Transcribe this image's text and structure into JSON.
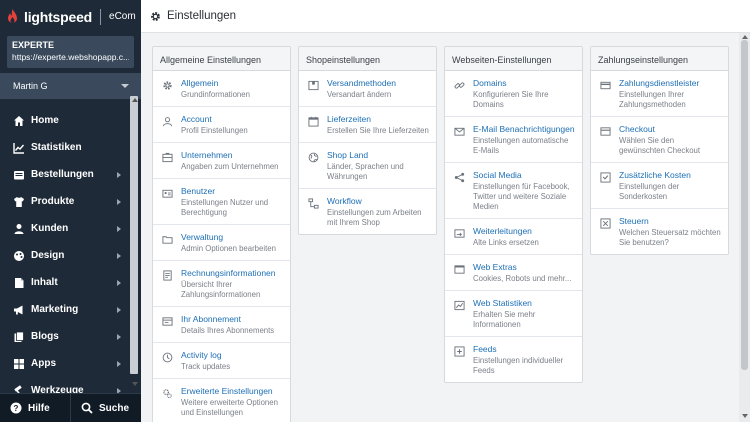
{
  "sidebar": {
    "logo_text": "lightspeed",
    "logo_product": "eCom",
    "shop_name": "EXPERTE",
    "shop_url": "https://experte.webshopapp.c...",
    "user_name": "Martin G",
    "items": [
      {
        "label": "Home",
        "icon": "home-icon",
        "has_children": false
      },
      {
        "label": "Statistiken",
        "icon": "chart-icon",
        "has_children": false
      },
      {
        "label": "Bestellungen",
        "icon": "inbox-icon",
        "has_children": true
      },
      {
        "label": "Produkte",
        "icon": "tshirt-icon",
        "has_children": true
      },
      {
        "label": "Kunden",
        "icon": "users-icon",
        "has_children": true
      },
      {
        "label": "Design",
        "icon": "palette-icon",
        "has_children": true
      },
      {
        "label": "Inhalt",
        "icon": "content-icon",
        "has_children": true
      },
      {
        "label": "Marketing",
        "icon": "megaphone-icon",
        "has_children": true
      },
      {
        "label": "Blogs",
        "icon": "blog-icon",
        "has_children": true
      },
      {
        "label": "Apps",
        "icon": "apps-icon",
        "has_children": true
      },
      {
        "label": "Werkzeuge",
        "icon": "hammer-icon",
        "has_children": true
      }
    ],
    "footer": {
      "help_label": "Hilfe",
      "search_label": "Suche"
    }
  },
  "header": {
    "title": "Einstellungen",
    "icon": "gear-icon"
  },
  "columns": [
    {
      "title": "Allgemeine Einstellungen",
      "items": [
        {
          "title": "Allgemein",
          "desc": "Grundinformationen",
          "icon": "gear-icon"
        },
        {
          "title": "Account",
          "desc": "Profil Einstellungen",
          "icon": "user-icon"
        },
        {
          "title": "Unternehmen",
          "desc": "Angaben zum Unternehmen",
          "icon": "card-icon"
        },
        {
          "title": "Benutzer",
          "desc": "Einstellungen Nutzer und Berechtigung",
          "icon": "id-badge-icon"
        },
        {
          "title": "Verwaltung",
          "desc": "Admin Optionen bearbeiten",
          "icon": "folder-icon"
        },
        {
          "title": "Rechnungsinformationen",
          "desc": "Übersicht Ihrer Zahlungsinformationen",
          "icon": "document-icon"
        },
        {
          "title": "Ihr Abonnement",
          "desc": "Details Ihres Abonnements",
          "icon": "subscription-icon"
        },
        {
          "title": "Activity log",
          "desc": "Track updates",
          "icon": "clock-icon"
        },
        {
          "title": "Erweiterte Einstellungen",
          "desc": "Weitere erweiterte Optionen und Einstellungen",
          "icon": "gears-icon"
        }
      ]
    },
    {
      "title": "Shopeinstellungen",
      "items": [
        {
          "title": "Versandmethoden",
          "desc": "Versandart ändern",
          "icon": "box-icon"
        },
        {
          "title": "Lieferzeiten",
          "desc": "Erstellen Sie Ihre Lieferzeiten",
          "icon": "calendar-icon"
        },
        {
          "title": "Shop Land",
          "desc": "Länder, Sprachen und Währungen",
          "icon": "globe-icon"
        },
        {
          "title": "Workflow",
          "desc": "Einstellungen zum Arbeiten mit Ihrem Shop",
          "icon": "workflow-icon"
        }
      ]
    },
    {
      "title": "Webseiten-Einstellungen",
      "items": [
        {
          "title": "Domains",
          "desc": "Konfigurieren Sie Ihre Domains",
          "icon": "link-icon"
        },
        {
          "title": "E-Mail Benachrichtigungen",
          "desc": "Einstellungen automatische E-Mails",
          "icon": "mail-icon"
        },
        {
          "title": "Social Media",
          "desc": "Einstellungen für Facebook, Twitter und weitere Soziale Medien",
          "icon": "share-icon"
        },
        {
          "title": "Weiterleitungen",
          "desc": "Alte Links ersetzen",
          "icon": "redirect-icon"
        },
        {
          "title": "Web Extras",
          "desc": "Cookies, Robots und mehr...",
          "icon": "code-icon"
        },
        {
          "title": "Web Statistiken",
          "desc": "Erhalten Sie mehr Informationen",
          "icon": "stats-icon"
        },
        {
          "title": "Feeds",
          "desc": "Einstellungen individueller Feeds",
          "icon": "feed-icon"
        }
      ]
    },
    {
      "title": "Zahlungseinstellungen",
      "items": [
        {
          "title": "Zahlungsdienstleister",
          "desc": "Einstellungen Ihrer Zahlungsmethoden",
          "icon": "credit-card-icon"
        },
        {
          "title": "Checkout",
          "desc": "Wählen Sie den gewünschten Checkout",
          "icon": "cart-icon"
        },
        {
          "title": "Zusätzliche Kosten",
          "desc": "Einstellungen der Sonderkosten",
          "icon": "tag-icon"
        },
        {
          "title": "Steuern",
          "desc": "Welchen Steuersatz möchten Sie benutzen?",
          "icon": "tax-icon"
        }
      ]
    }
  ],
  "colors": {
    "sidebar_bg": "#1e2a37",
    "accent_link": "#1d6fb5",
    "logo_red": "#e4413b"
  }
}
